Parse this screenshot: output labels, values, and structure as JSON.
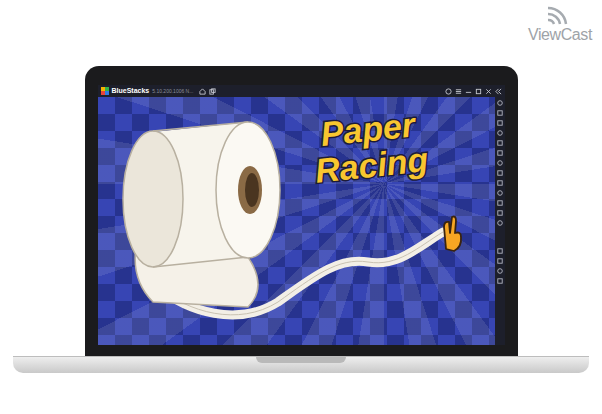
{
  "watermark": {
    "brand": "ViewCast"
  },
  "window": {
    "title": "BlueStacks",
    "version": "5.10.200.1006 N..."
  },
  "game": {
    "title_lines": [
      "Paper",
      "Racing"
    ]
  }
}
